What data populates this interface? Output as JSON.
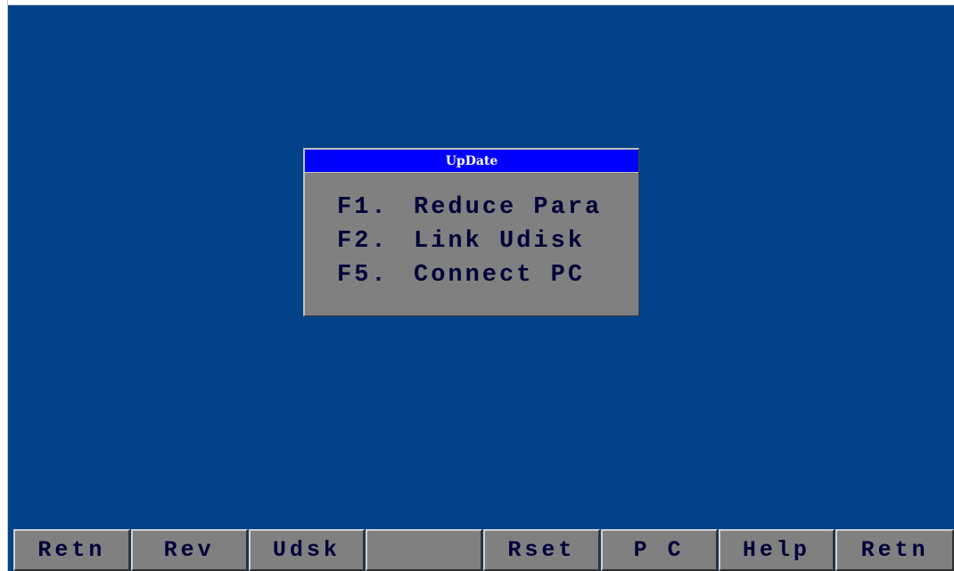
{
  "dialog": {
    "title": "UpDate",
    "items": [
      {
        "key": "F1.",
        "label": "Reduce Para"
      },
      {
        "key": "F2.",
        "label": "Link Udisk"
      },
      {
        "key": "F5.",
        "label": "Connect PC"
      }
    ]
  },
  "function_keys": [
    "Retn",
    "Rev",
    "Udsk",
    "",
    "Rset",
    "P C",
    "Help",
    "Retn"
  ],
  "colors": {
    "background": "#024288",
    "dialog_body": "#808080",
    "dialog_titlebar": "#0000ff",
    "text": "#00003a"
  }
}
